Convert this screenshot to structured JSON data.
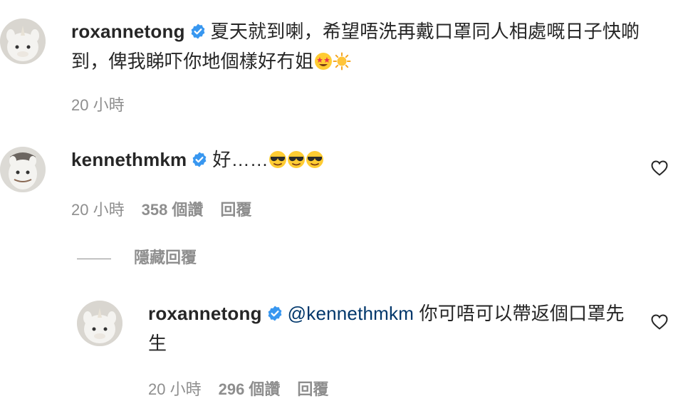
{
  "comments": [
    {
      "username": "roxannetong",
      "text": "夏天就到喇，希望唔洗再戴口罩同人相處嘅日子快啲到，俾我睇吓你地個樣好冇姐",
      "emoji": [
        "star-struck-emoji",
        "sun-emoji"
      ],
      "time": "20 小時"
    },
    {
      "username": "kennethmkm",
      "text": "好……",
      "emoji": [
        "sunglasses-emoji",
        "sunglasses-emoji",
        "sunglasses-emoji"
      ],
      "time": "20 小時",
      "likes": "358 個讚",
      "reply_label": "回覆"
    }
  ],
  "hide_replies_label": "隱藏回覆",
  "reply": {
    "username": "roxannetong",
    "mention": "@kennethmkm",
    "text": " 你可唔可以帶返個口罩先生",
    "time": "20 小時",
    "likes": "296 個讚",
    "reply_label": "回覆"
  },
  "icons": {
    "verified": "verified-badge-icon",
    "like": "heart-icon"
  },
  "colors": {
    "verified": "#3897f0",
    "mention": "#00376b",
    "meta": "#8e8e8e",
    "text": "#262626"
  }
}
